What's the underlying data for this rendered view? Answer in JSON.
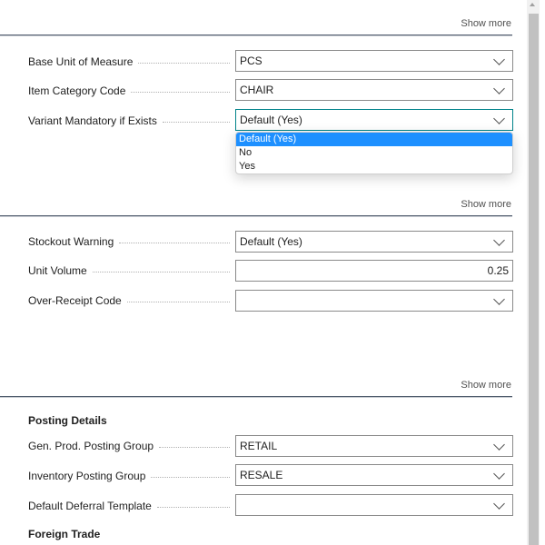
{
  "show_more_label": "Show more",
  "section1": {
    "fields": [
      {
        "label": "Base Unit of Measure",
        "value": "PCS"
      },
      {
        "label": "Item Category Code",
        "value": "CHAIR"
      },
      {
        "label": "Variant Mandatory if Exists",
        "value": "Default (Yes)"
      }
    ]
  },
  "dropdown": {
    "options": [
      "Default (Yes)",
      "No",
      "Yes"
    ],
    "selected": "Default (Yes)"
  },
  "section2": {
    "fields": [
      {
        "label": "Stockout Warning",
        "value": "Default (Yes)"
      },
      {
        "label": "Unit Volume",
        "value": "0.25"
      },
      {
        "label": "Over-Receipt Code",
        "value": ""
      }
    ]
  },
  "section3": {
    "heading": "Posting Details",
    "fields": [
      {
        "label": "Gen. Prod. Posting Group",
        "value": "RETAIL"
      },
      {
        "label": "Inventory Posting Group",
        "value": "RESALE"
      },
      {
        "label": "Default Deferral Template",
        "value": ""
      }
    ],
    "next_heading": "Foreign Trade"
  },
  "colors": {
    "focus": "#00838a",
    "selected_option": "#1e90ff"
  }
}
